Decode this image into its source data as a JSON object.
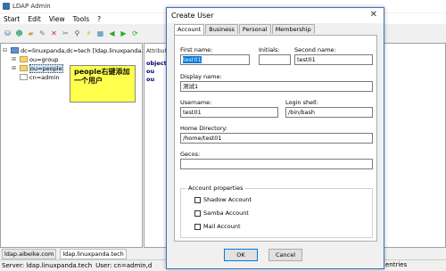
{
  "app": {
    "title": "LDAP Admin"
  },
  "menu": [
    "Start",
    "Edit",
    "View",
    "Tools",
    "?"
  ],
  "tree": {
    "root": "dc=linuxpanda,dc=tech [ldap.linuxpanda.t",
    "children": [
      "ou=group",
      "ou=people",
      "cn=admin"
    ]
  },
  "attributes": {
    "header": "Attribute",
    "rows": [
      "objectC",
      "ou",
      "ou"
    ]
  },
  "callout": {
    "text": "people右键添加一个用户"
  },
  "bottom_tabs": [
    "ldap.aibeike.com",
    "ldap.linuxpanda.tech"
  ],
  "status": {
    "server": "Server: ldap.linuxpanda.tech",
    "user": "User: cn=admin,d",
    "right": "entries"
  },
  "dialog": {
    "title": "Create User",
    "close": "✕",
    "tabs": [
      "Account",
      "Business",
      "Personal",
      "Membership"
    ],
    "first_name_label": "First name:",
    "first_name": "test01",
    "initials_label": "Initials:",
    "initials": "",
    "second_name_label": "Second name:",
    "second_name": "test01",
    "display_name_label": "Display name:",
    "display_name": "测试1",
    "username_label": "Username:",
    "username": "test01",
    "login_shell_label": "Login shell:",
    "login_shell": "/bin/bash",
    "home_label": "Home Directory:",
    "home": "/home/test01",
    "gecos_label": "Gecos:",
    "gecos": "",
    "props_label": "Account properties",
    "checks": [
      "Shadow Account",
      "Samba Account",
      "Mail Account"
    ],
    "ok": "OK",
    "cancel": "Cancel"
  }
}
